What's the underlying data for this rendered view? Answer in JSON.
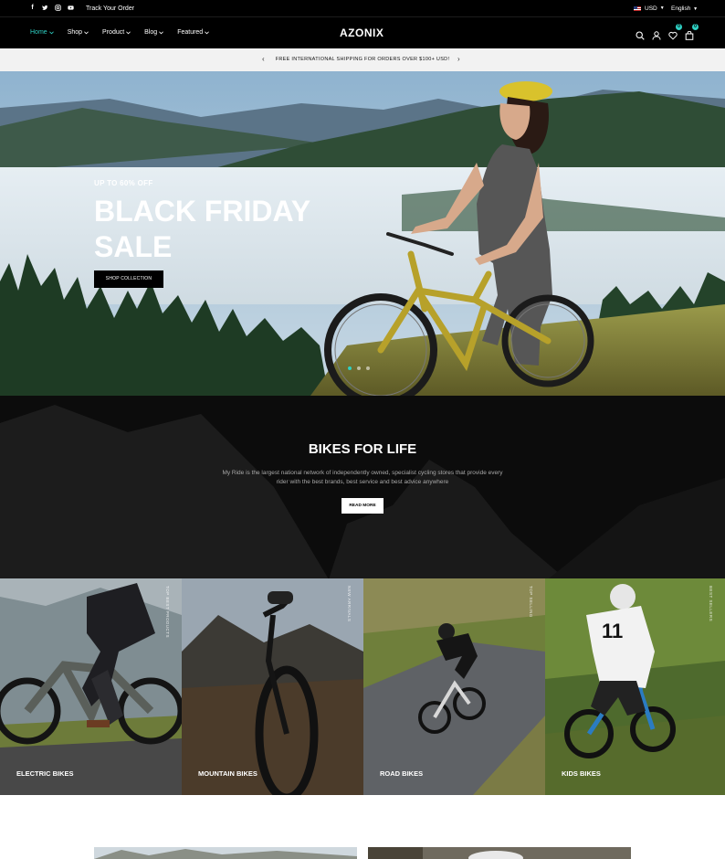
{
  "topbar": {
    "social_icons": [
      "facebook-icon",
      "twitter-icon",
      "instagram-icon",
      "youtube-icon"
    ],
    "track_order": "Track Your Order",
    "currency": "USD",
    "language": "English"
  },
  "nav": {
    "items": [
      {
        "label": "Home",
        "active": true
      },
      {
        "label": "Shop",
        "active": false
      },
      {
        "label": "Product",
        "active": false
      },
      {
        "label": "Blog",
        "active": false
      },
      {
        "label": "Featured",
        "active": false
      }
    ],
    "logo": "AZONIX",
    "wishlist_count": "0",
    "cart_count": "0",
    "icons": [
      "search-icon",
      "user-icon",
      "heart-icon",
      "bag-icon"
    ]
  },
  "announcement": {
    "message": "FREE INTERNATIONAL SHIPPING FOR ORDERS OVER $100+ USD!",
    "prev": "‹",
    "next": "›"
  },
  "hero": {
    "eyebrow": "UP TO 60% OFF",
    "title": "BLACK FRIDAY SALE",
    "cta": "SHOP COLLECTION",
    "slides": 3,
    "active_slide": 1
  },
  "story": {
    "heading": "BIKES FOR LIFE",
    "body": "My Ride is the largest national network of independently owned, specialist cycling stores that provide every rider with the best brands, best service and best advice anywhere",
    "button": "READ MORE"
  },
  "categories": [
    {
      "label": "ELECTRIC BIKES",
      "side": "TOP BEST PRODUCTS"
    },
    {
      "label": "MOUNTAIN BIKES",
      "side": "NEW ARRIVALS"
    },
    {
      "label": "ROAD BIKES",
      "side": "TOP SELLING"
    },
    {
      "label": "KIDS BIKES",
      "side": "BEST SELLERS"
    }
  ],
  "colors": {
    "accent": "#2fd1c4",
    "dark": "#000000",
    "announce_bg": "#f2f2f2"
  }
}
